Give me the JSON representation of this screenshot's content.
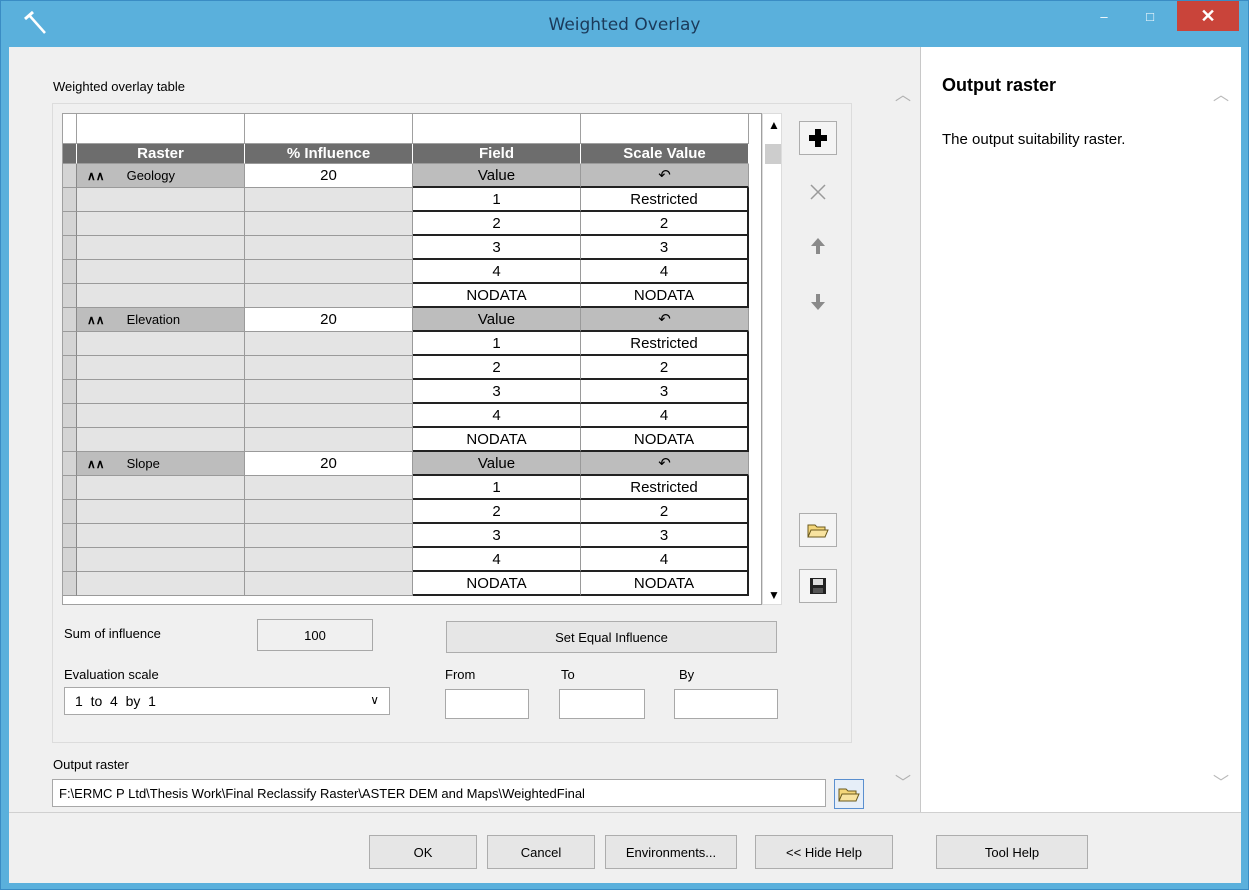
{
  "window": {
    "title": "Weighted Overlay",
    "minimize_glyph": "–",
    "maximize_glyph": "□",
    "close_glyph": "✕"
  },
  "weighted_table": {
    "label": "Weighted overlay table",
    "columns": [
      "Raster",
      "% Influence",
      "Field",
      "Scale Value"
    ],
    "groups": [
      {
        "raster": "Geology",
        "influence": "20",
        "field": "Value",
        "rows": [
          {
            "field": "1",
            "scale": "Restricted"
          },
          {
            "field": "2",
            "scale": "2"
          },
          {
            "field": "3",
            "scale": "3"
          },
          {
            "field": "4",
            "scale": "4"
          },
          {
            "field": "NODATA",
            "scale": "NODATA"
          }
        ]
      },
      {
        "raster": "Elevation",
        "influence": "20",
        "field": "Value",
        "rows": [
          {
            "field": "1",
            "scale": "Restricted"
          },
          {
            "field": "2",
            "scale": "2"
          },
          {
            "field": "3",
            "scale": "3"
          },
          {
            "field": "4",
            "scale": "4"
          },
          {
            "field": "NODATA",
            "scale": "NODATA"
          }
        ]
      },
      {
        "raster": "Slope",
        "influence": "20",
        "field": "Value",
        "rows": [
          {
            "field": "1",
            "scale": "Restricted"
          },
          {
            "field": "2",
            "scale": "2"
          },
          {
            "field": "3",
            "scale": "3"
          },
          {
            "field": "4",
            "scale": "4"
          },
          {
            "field": "NODATA",
            "scale": "NODATA"
          }
        ]
      }
    ]
  },
  "sum_of_influence": {
    "label": "Sum of influence",
    "value": "100"
  },
  "set_equal_influence": "Set Equal Influence",
  "evaluation_scale": {
    "label": "Evaluation scale",
    "selected": "1  to  4  by  1",
    "from_label": "From",
    "to_label": "To",
    "by_label": "By",
    "from_value": "",
    "to_value": "",
    "by_value": ""
  },
  "output_raster": {
    "label": "Output raster",
    "value": "F:\\ERMC P Ltd\\Thesis Work\\Final Reclassify Raster\\ASTER DEM and Maps\\WeightedFinal"
  },
  "help": {
    "title": "Output raster",
    "text": "The output suitability raster."
  },
  "buttons": {
    "ok": "OK",
    "cancel": "Cancel",
    "environments": "Environments...",
    "hide_help": "<< Hide Help",
    "tool_help": "Tool Help"
  },
  "colors": {
    "titlebar": "#5ab0dc",
    "header": "#6d6d6d",
    "close": "#c9443a"
  }
}
